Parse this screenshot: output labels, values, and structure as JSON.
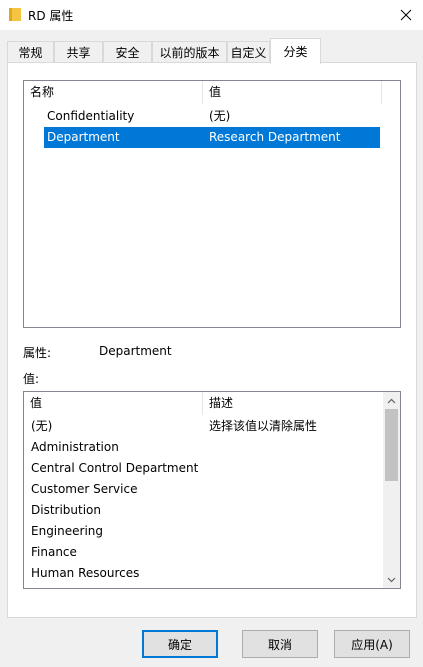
{
  "window": {
    "title": "RD 属性"
  },
  "tabs": [
    {
      "label": "常规"
    },
    {
      "label": "共享"
    },
    {
      "label": "安全"
    },
    {
      "label": "以前的版本"
    },
    {
      "label": "自定义"
    },
    {
      "label": "分类"
    }
  ],
  "properties_list": {
    "headers": {
      "name": "名称",
      "value": "值"
    },
    "rows": [
      {
        "name": "Confidentiality",
        "value": "(无)"
      },
      {
        "name": "Department",
        "value": "Research Department"
      }
    ]
  },
  "property": {
    "label": "属性:",
    "value": "Department"
  },
  "value_label": "值:",
  "values_list": {
    "headers": {
      "value": "值",
      "description": "描述"
    },
    "rows": [
      {
        "value": "(无)",
        "description": "选择该值以清除属性"
      },
      {
        "value": "Administration",
        "description": ""
      },
      {
        "value": "Central Control Department",
        "description": ""
      },
      {
        "value": "Customer Service",
        "description": ""
      },
      {
        "value": "Distribution",
        "description": ""
      },
      {
        "value": "Engineering",
        "description": ""
      },
      {
        "value": "Finance",
        "description": ""
      },
      {
        "value": "Human Resources",
        "description": ""
      }
    ]
  },
  "buttons": {
    "ok": "确定",
    "cancel": "取消",
    "apply": "应用(A)"
  },
  "colors": {
    "selection": "#0078d7",
    "folder": "#f5c542"
  }
}
